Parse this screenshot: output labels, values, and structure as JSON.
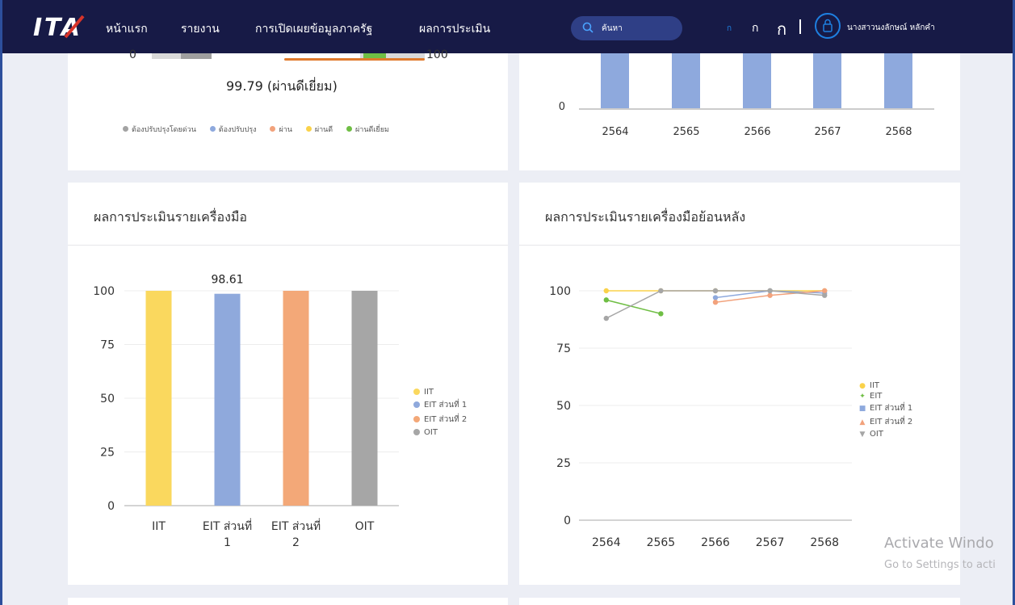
{
  "nav": {
    "logo": "ITA",
    "items": [
      "หน้าแรก",
      "รายงาน",
      "การเปิดเผยข้อมูลภาครัฐ",
      "ผลการประเมิน"
    ],
    "search_placeholder": "ค้นหา",
    "font_sizes": [
      "ก",
      "ก",
      "ก"
    ],
    "divider": "|",
    "user_name": "นางสาวนงลักษณ์ หลักคำ"
  },
  "top_left": {
    "gauge_min": "0",
    "gauge_max": "100",
    "score": "99.79 (ผ่านดีเยี่ยม)",
    "legend": [
      {
        "label": "ต้องปรับปรุงโดยด่วน",
        "color": "#a3a3a3"
      },
      {
        "label": "ต้องปรับปรุง",
        "color": "#8ea9dd"
      },
      {
        "label": "ผ่าน",
        "color": "#f2a27c"
      },
      {
        "label": "ผ่านดี",
        "color": "#fad24a"
      },
      {
        "label": "ผ่านดีเยี่ยม",
        "color": "#6fbe44"
      }
    ]
  },
  "top_right": {
    "y_zero": "0",
    "years": [
      "2564",
      "2565",
      "2566",
      "2567",
      "2568"
    ]
  },
  "tool_card": {
    "title": "ผลการประเมินรายเครื่องมือ"
  },
  "history_card": {
    "title": "ผลการประเมินรายเครื่องมือย้อนหลัง"
  },
  "chart_data": [
    {
      "type": "bar",
      "categories": [
        "IIT",
        "EIT ส่วนที่ 1",
        "EIT ส่วนที่ 2",
        "OIT"
      ],
      "values": [
        100,
        98.61,
        100,
        100
      ],
      "colors": [
        "#fad85e",
        "#8fa9dc",
        "#f3a878",
        "#a6a6a6"
      ],
      "data_labels": [
        {
          "category": "EIT ส่วนที่ 1",
          "text": "98.61"
        }
      ],
      "legend": [
        "IIT",
        "EIT ส่วนที่ 1",
        "EIT ส่วนที่ 2",
        "OIT"
      ],
      "ylim": [
        0,
        100
      ],
      "yticks": [
        "0",
        "25",
        "50",
        "75",
        "100"
      ],
      "legend_position": "right",
      "grid": true
    },
    {
      "type": "line",
      "x": [
        "2564",
        "2565",
        "2566",
        "2567",
        "2568"
      ],
      "series": [
        {
          "name": "IIT",
          "color": "#fad24a",
          "marker": "●",
          "values": [
            100,
            100,
            100,
            100,
            100
          ]
        },
        {
          "name": "EIT",
          "color": "#6fbe44",
          "marker": "✦",
          "values": [
            96,
            90,
            null,
            null,
            null
          ]
        },
        {
          "name": "EIT ส่วนที่ 1",
          "color": "#8ea9dd",
          "marker": "■",
          "values": [
            null,
            null,
            97,
            100,
            99
          ]
        },
        {
          "name": "EIT ส่วนที่ 2",
          "color": "#f2a27c",
          "marker": "▲",
          "values": [
            null,
            null,
            95,
            98,
            100
          ]
        },
        {
          "name": "OIT",
          "color": "#a6a6a6",
          "marker": "▼",
          "values": [
            88,
            100,
            100,
            100,
            98
          ]
        }
      ],
      "ylim": [
        0,
        100
      ],
      "yticks": [
        "0",
        "25",
        "50",
        "75",
        "100"
      ],
      "legend_position": "right",
      "grid": true
    }
  ],
  "watermark": {
    "line1": "Activate Windo",
    "line2": "Go to Settings to acti"
  }
}
